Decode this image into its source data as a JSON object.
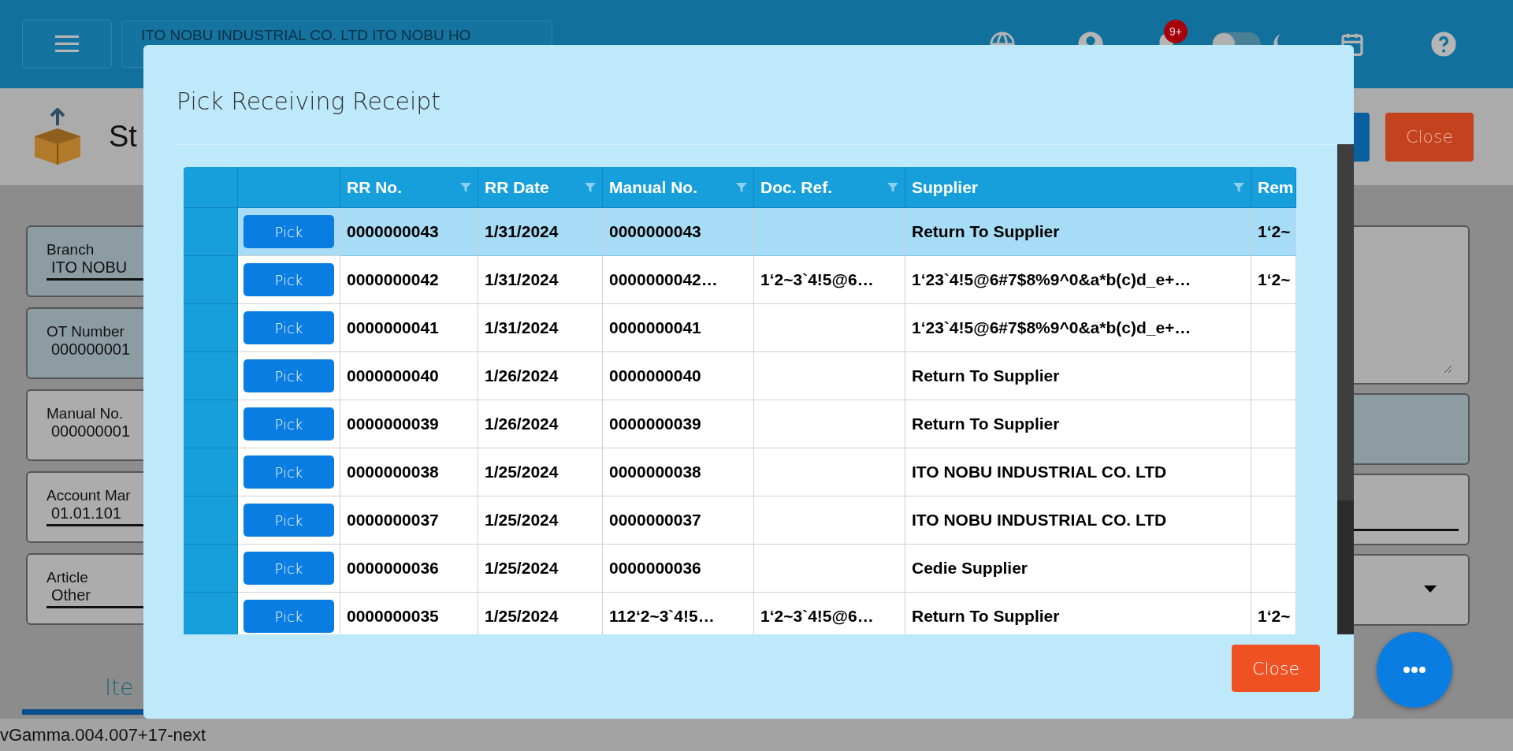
{
  "top_bar": {
    "company": "ITO NOBU INDUSTRIAL CO. LTD ITO NOBU HO",
    "notification_badge": "9+",
    "dark_mode": false
  },
  "page": {
    "title": "St",
    "close_button": "Close"
  },
  "form_left": [
    {
      "label": "Branch",
      "value": "ITO NOBU",
      "kind": "underlined",
      "disabled": true
    },
    {
      "label": "OT Number",
      "value": "000000001",
      "kind": "plain",
      "disabled": true
    },
    {
      "label": "Manual No.",
      "value": "000000001",
      "kind": "plain",
      "disabled": false
    },
    {
      "label": "Account Mar",
      "value": "01.01.101",
      "kind": "underlined",
      "disabled": false
    },
    {
      "label": "Article",
      "value": "Other",
      "kind": "underlined",
      "disabled": false
    }
  ],
  "form_right": [
    {
      "kind": "textarea",
      "disabled": false
    },
    {
      "kind": "plain",
      "disabled": true
    },
    {
      "kind": "underlined",
      "disabled": false
    },
    {
      "kind": "dropdown",
      "disabled": false
    }
  ],
  "tabs": [
    {
      "label": "Ite",
      "selected": true
    }
  ],
  "version": "vGamma.004.007+17-next",
  "dialog": {
    "title": "Pick Receiving Receipt",
    "columns": [
      {
        "label": "RR No.",
        "filter": true
      },
      {
        "label": "RR Date",
        "filter": true
      },
      {
        "label": "Manual No.",
        "filter": true
      },
      {
        "label": "Doc. Ref.",
        "filter": true
      },
      {
        "label": "Supplier",
        "filter": true
      },
      {
        "label": "Rem",
        "filter": false
      }
    ],
    "rows": [
      {
        "selected": true,
        "pick": "Pick",
        "cells": [
          "0000000043",
          "1/31/2024",
          "0000000043",
          "",
          "Return To Supplier",
          "1‘2~"
        ]
      },
      {
        "selected": false,
        "pick": "Pick",
        "cells": [
          "0000000042",
          "1/31/2024",
          "0000000042…",
          "1‘2~3`4!5@6…",
          "1‘23`4!5@6#7$8%9^0&a*b(c)d_e+…",
          "1‘2~"
        ]
      },
      {
        "selected": false,
        "pick": "Pick",
        "cells": [
          "0000000041",
          "1/31/2024",
          "0000000041",
          "",
          "1‘23`4!5@6#7$8%9^0&a*b(c)d_e+…",
          ""
        ]
      },
      {
        "selected": false,
        "pick": "Pick",
        "cells": [
          "0000000040",
          "1/26/2024",
          "0000000040",
          "",
          "Return To Supplier",
          ""
        ]
      },
      {
        "selected": false,
        "pick": "Pick",
        "cells": [
          "0000000039",
          "1/26/2024",
          "0000000039",
          "",
          "Return To Supplier",
          ""
        ]
      },
      {
        "selected": false,
        "pick": "Pick",
        "cells": [
          "0000000038",
          "1/25/2024",
          "0000000038",
          "",
          "ITO NOBU INDUSTRIAL CO. LTD",
          ""
        ]
      },
      {
        "selected": false,
        "pick": "Pick",
        "cells": [
          "0000000037",
          "1/25/2024",
          "0000000037",
          "",
          "ITO NOBU INDUSTRIAL CO. LTD",
          ""
        ]
      },
      {
        "selected": false,
        "pick": "Pick",
        "cells": [
          "0000000036",
          "1/25/2024",
          "0000000036",
          "",
          "Cedie Supplier",
          ""
        ]
      },
      {
        "selected": false,
        "pick": "Pick",
        "cells": [
          "0000000035",
          "1/25/2024",
          "112‘2~3`4!5…",
          "1‘2~3`4!5@6…",
          "Return To Supplier",
          "1‘2~"
        ]
      }
    ],
    "close_button": "Close"
  }
}
